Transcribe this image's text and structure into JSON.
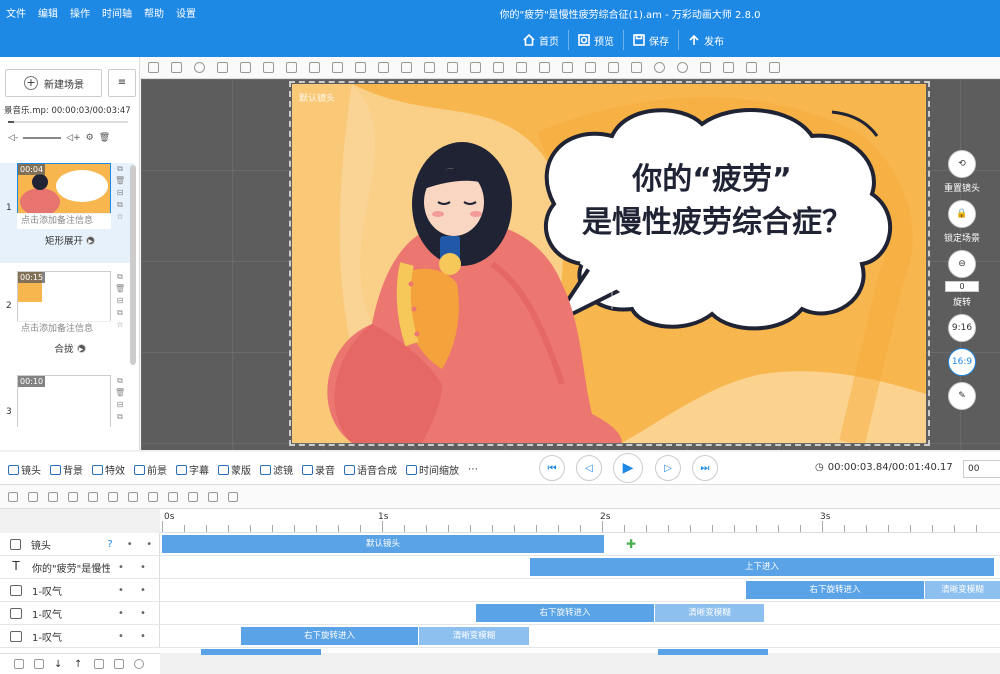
{
  "menu": [
    "文件",
    "编辑",
    "操作",
    "时间轴",
    "帮助",
    "设置"
  ],
  "app_title": "你的\"疲劳\"是慢性疲劳综合征(1).am - 万彩动画大师 2.8.0",
  "top_buttons": [
    {
      "label": "首页",
      "icon": "home-icon"
    },
    {
      "label": "预览",
      "icon": "preview-icon"
    },
    {
      "label": "保存",
      "icon": "save-icon"
    },
    {
      "label": "发布",
      "icon": "publish-icon"
    }
  ],
  "left": {
    "new_scene": "新建场景",
    "music": "景音乐.mp: 00:00:03/00:03:47",
    "scenes": [
      {
        "idx": "1",
        "dur": "00:04",
        "note": "点击添加备注信息",
        "trans": "矩形展开"
      },
      {
        "idx": "2",
        "dur": "00:15",
        "note": "点击添加备注信息",
        "trans": "合拢"
      },
      {
        "idx": "3",
        "dur": "00:10",
        "note": "",
        "trans": ""
      }
    ]
  },
  "canvas": {
    "camera_label": "默认镜头",
    "bubble_line1": "你的“疲劳”",
    "bubble_line2": "是慢性疲劳综合症？"
  },
  "right_controls": {
    "reset": "重置镜头",
    "lock": "锁定场景",
    "rotate": "旋转",
    "rotate_value": "0",
    "ratio1": "9:16",
    "ratio2": "16:9"
  },
  "bottom_tools": [
    "镜头",
    "背景",
    "特效",
    "前景",
    "字幕",
    "蒙版",
    "滤镜",
    "录音",
    "语音合成",
    "时间缩放"
  ],
  "timecode": "00:00:03.84/00:01:40.17",
  "zoom": "00",
  "ruler": [
    "0s",
    "1s",
    "2s",
    "3s"
  ],
  "tracks": [
    {
      "name": "镜头",
      "icon": "camera-icon",
      "clips": [
        {
          "label": "默认镜头"
        }
      ]
    },
    {
      "name": "你的\"疲劳\"是慢性疲劳",
      "icon": "text-icon",
      "clips": [
        {
          "label": "上下进入"
        }
      ]
    },
    {
      "name": "1-叹气",
      "icon": "image-icon",
      "clips": [
        {
          "label": "右下旋转进入"
        },
        {
          "label": "清晰变模糊"
        }
      ]
    },
    {
      "name": "1-叹气",
      "icon": "image-icon",
      "clips": [
        {
          "label": "右下旋转进入"
        },
        {
          "label": "清晰变模糊"
        }
      ]
    },
    {
      "name": "1-叹气",
      "icon": "image-icon",
      "clips": [
        {
          "label": "右下旋转进入"
        },
        {
          "label": "清晰变模糊"
        }
      ]
    }
  ],
  "colors": {
    "brand": "#1e88e5",
    "clip": "#5aa3e6",
    "stage_bg": "#f7b74e"
  }
}
